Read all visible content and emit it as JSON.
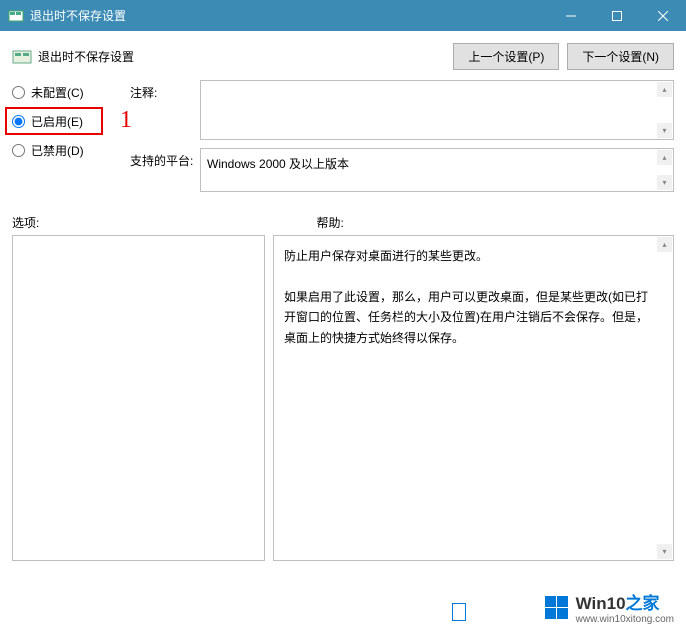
{
  "titlebar": {
    "title": "退出时不保存设置"
  },
  "header": {
    "title": "退出时不保存设置",
    "prev": "上一个设置(P)",
    "next": "下一个设置(N)"
  },
  "radios": {
    "not_configured": "未配置(C)",
    "enabled": "已启用(E)",
    "disabled": "已禁用(D)",
    "selected": "enabled"
  },
  "annotation": "1",
  "meta": {
    "comment_label": "注释:",
    "comment_text": "",
    "platform_label": "支持的平台:",
    "platform_text": "Windows 2000 及以上版本"
  },
  "columns": {
    "options_label": "选项:",
    "help_label": "帮助:"
  },
  "help": {
    "p1": "防止用户保存对桌面进行的某些更改。",
    "p2": "如果启用了此设置，那么，用户可以更改桌面，但是某些更改(如已打开窗口的位置、任务栏的大小及位置)在用户注销后不会保存。但是，桌面上的快捷方式始终得以保存。"
  },
  "watermark": {
    "line1a": "Win10",
    "line1b": "之家",
    "line2": "www.win10xitong.com"
  }
}
